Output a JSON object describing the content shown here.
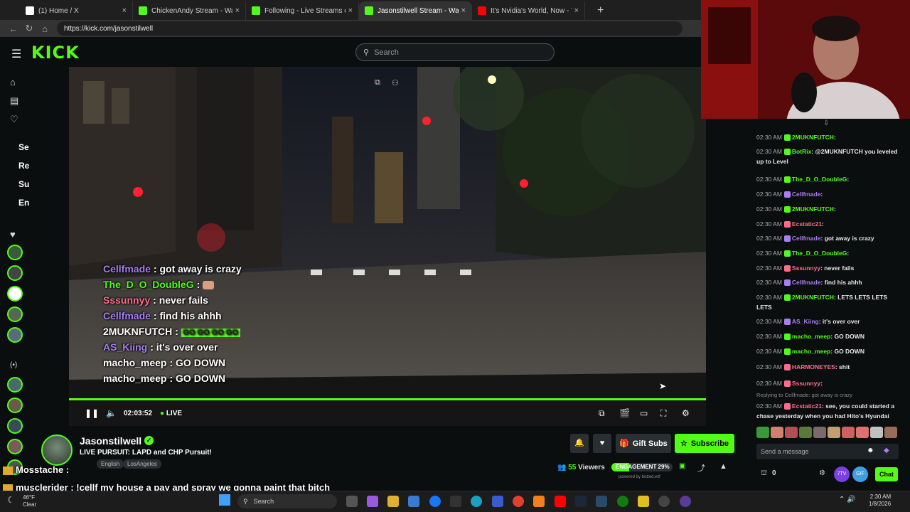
{
  "browser": {
    "tabs": [
      {
        "title": "(1) Home / X",
        "icon": "x-logo-icon",
        "color": "#ffffff",
        "active": false
      },
      {
        "title": "ChickenAndy Stream - Watch Live",
        "icon": "kick-logo-icon",
        "color": "#53fc18",
        "active": false
      },
      {
        "title": "Following - Live Streams on Kick",
        "icon": "kick-logo-icon",
        "color": "#53fc18",
        "active": false
      },
      {
        "title": "Jasonstilwell Stream - Watch L",
        "icon": "kick-logo-icon",
        "color": "#53fc18",
        "active": true
      },
      {
        "title": "It's Nvidia's World, Now - YouTube",
        "icon": "youtube-logo-icon",
        "color": "#ff0000",
        "active": false
      }
    ],
    "url": "https://kick.com/jasonstilwell"
  },
  "kick": {
    "search_placeholder": "Search",
    "rail_sections": [
      "Se",
      "Re",
      "Su",
      "En"
    ],
    "brand_color": "#53fc18"
  },
  "video": {
    "overlay_chat": [
      {
        "user": "Cellfmade",
        "msg": "got away is crazy",
        "color": "#a87ef0"
      },
      {
        "user": "The_D_O_DoubleG",
        "msg": "",
        "color": "#53fc18"
      },
      {
        "user": "Sssunnyy",
        "msg": "never fails",
        "color": "#ff6b8a"
      },
      {
        "user": "Cellfmade",
        "msg": "find his ahhh",
        "color": "#a87ef0"
      },
      {
        "user": "2MUKNFUTCH",
        "msg": "GO GO GO GO",
        "color": "#ffffff"
      },
      {
        "user": "AS_Kiing",
        "msg": "it's over over",
        "color": "#a87ef0"
      },
      {
        "user": "macho_meep",
        "msg": "GO DOWN",
        "color": "#ffffff"
      },
      {
        "user": "macho_meep",
        "msg": "GO DOWN",
        "color": "#ffffff"
      }
    ],
    "time": "02:03:52",
    "live_label": "LIVE"
  },
  "channel": {
    "name": "Jasonstilwell",
    "title": "LIVE PURSUIT: LAPD and CHP Pursuit!",
    "tags": [
      "English",
      "LosAngeles"
    ],
    "gift_label": "Gift Subs",
    "subscribe_label": "Subscribe",
    "viewers": "55",
    "viewers_label": "Viewers",
    "engagement_label": "ENGAGEMENT 29%",
    "engagement_pct": 29,
    "engagement_powered": "powered by botted.wtf"
  },
  "bottom_overlay": [
    {
      "user": "Mosstache",
      "msg": ":"
    },
    {
      "user": "musclerider",
      "msg": ": !cellf my house a pay and spray we gonna paint that bitch"
    }
  ],
  "chat": {
    "messages": [
      {
        "time": "02:30 AM",
        "user": "2MUKNFUTCH",
        "ucolor": "#53fc18",
        "msg": ":"
      },
      {
        "time": "02:30 AM",
        "user": "BotRix",
        "ucolor": "#53fc18",
        "msg": ": @2MUKNFUTCH you leveled up to Level"
      },
      {
        "time": "02:30 AM",
        "user": "The_D_O_DoubleG",
        "ucolor": "#53fc18",
        "msg": ":"
      },
      {
        "time": "02:30 AM",
        "user": "Cellfmade",
        "ucolor": "#a87ef0",
        "msg": ":"
      },
      {
        "time": "02:30 AM",
        "user": "2MUKNFUTCH",
        "ucolor": "#53fc18",
        "msg": ":"
      },
      {
        "time": "02:30 AM",
        "user": "Ecstatic21",
        "ucolor": "#ff6b8a",
        "msg": ":"
      },
      {
        "time": "02:30 AM",
        "user": "Cellfmade",
        "ucolor": "#a87ef0",
        "msg": ": got away is crazy"
      },
      {
        "time": "02:30 AM",
        "user": "The_D_O_DoubleG",
        "ucolor": "#53fc18",
        "msg": ":"
      },
      {
        "time": "02:30 AM",
        "user": "Sssunnyy",
        "ucolor": "#ff6b8a",
        "msg": ": never fails"
      },
      {
        "time": "02:30 AM",
        "user": "Cellfmade",
        "ucolor": "#a87ef0",
        "msg": ": find his ahhh"
      },
      {
        "time": "02:30 AM",
        "user": "2MUKNFUTCH",
        "ucolor": "#53fc18",
        "msg": ": LETS LETS LETS LETS"
      },
      {
        "time": "02:30 AM",
        "user": "AS_Kiing",
        "ucolor": "#a87ef0",
        "msg": ": it's over over"
      },
      {
        "time": "02:30 AM",
        "user": "macho_meep",
        "ucolor": "#53fc18",
        "msg": ": GO DOWN"
      },
      {
        "time": "02:30 AM",
        "user": "macho_meep",
        "ucolor": "#53fc18",
        "msg": ": GO DOWN"
      },
      {
        "time": "02:30 AM",
        "user": "HARMONEYES",
        "ucolor": "#ff6b8a",
        "msg": ": shit"
      },
      {
        "time": "02:30 AM",
        "user": "Sssunnyy",
        "ucolor": "#ff6b8a",
        "msg": ":"
      },
      {
        "time": "",
        "user": "",
        "ucolor": "#888888",
        "msg": "Replying to Cellfmade: got away is crazy"
      },
      {
        "time": "02:30 AM",
        "user": "Ecstatic21",
        "ucolor": "#ff6b8a",
        "msg": ": see, you could started a chase yesterday when you had Hito's Hyundai"
      }
    ],
    "input_placeholder": "Send a message",
    "points": "0",
    "chat_button": "Chat"
  },
  "taskbar": {
    "temp": "46°F",
    "weather": "Clear",
    "search_label": "Search",
    "time": "2:30 AM",
    "date": "1/8/2026"
  }
}
